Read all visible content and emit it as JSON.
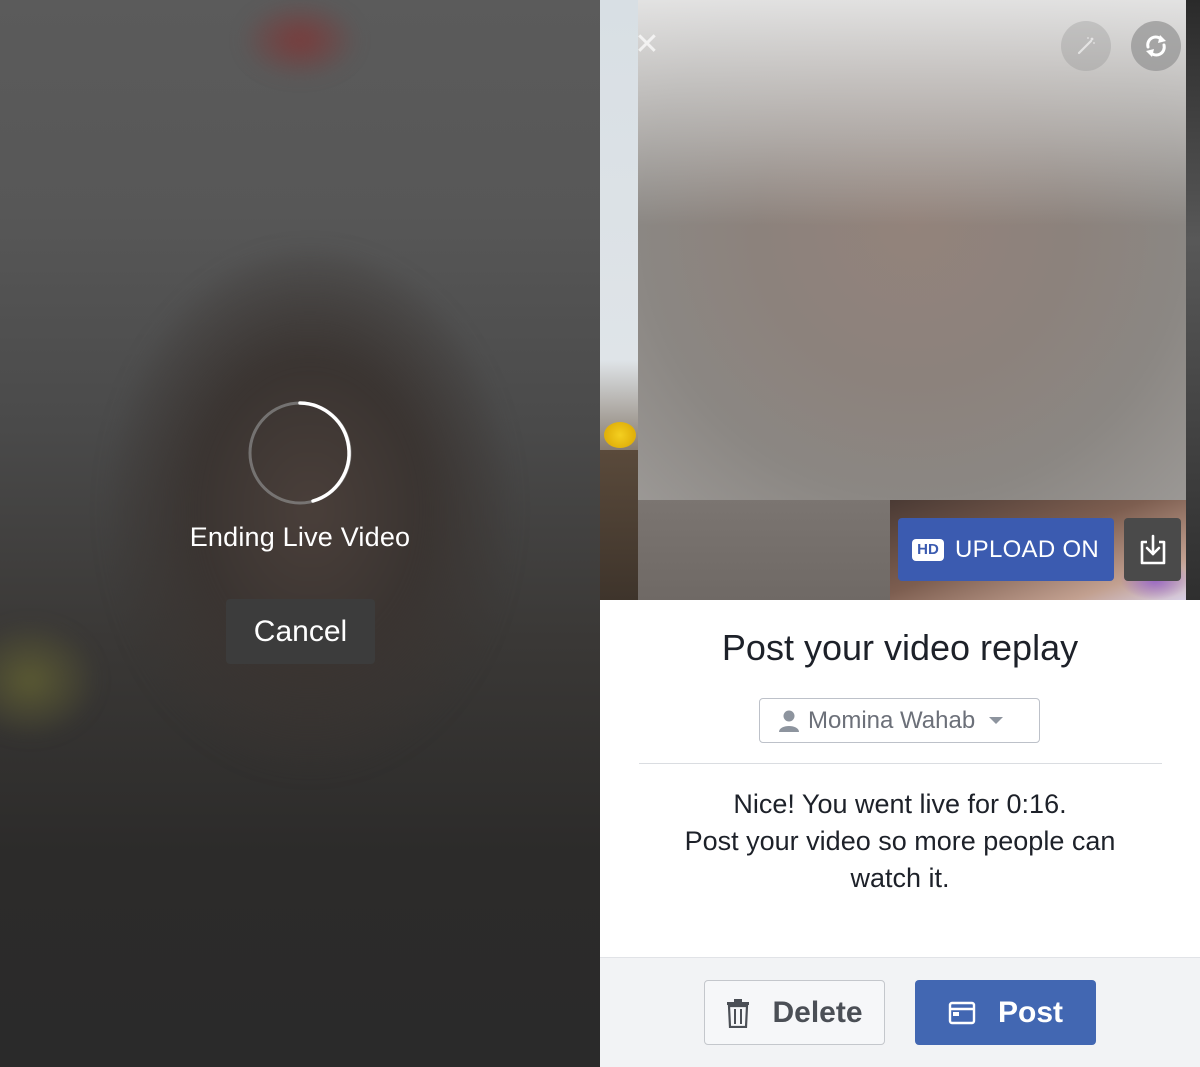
{
  "ending_screen": {
    "status_label": "Ending Live Video",
    "cancel_label": "Cancel"
  },
  "replay_screen": {
    "video_controls": {
      "close_icon": "close-icon",
      "effects_icon": "magic-wand-icon",
      "flip_icon": "camera-flip-icon",
      "hd_badge": "HD",
      "upload_label": "UPLOAD ON",
      "download_icon": "download-icon"
    },
    "title": "Post your video replay",
    "audience": {
      "icon": "person-icon",
      "name": "Momina Wahab",
      "dropdown_icon": "caret-down-icon"
    },
    "message_line1": "Nice! You went live for 0:16.",
    "message_line2": "Post your video so more people can watch it.",
    "actions": {
      "delete_label": "Delete",
      "post_label": "Post"
    }
  },
  "colors": {
    "primary_blue": "#4267b2",
    "upload_blue": "#3b5bb0",
    "text_dark": "#1d2129"
  }
}
